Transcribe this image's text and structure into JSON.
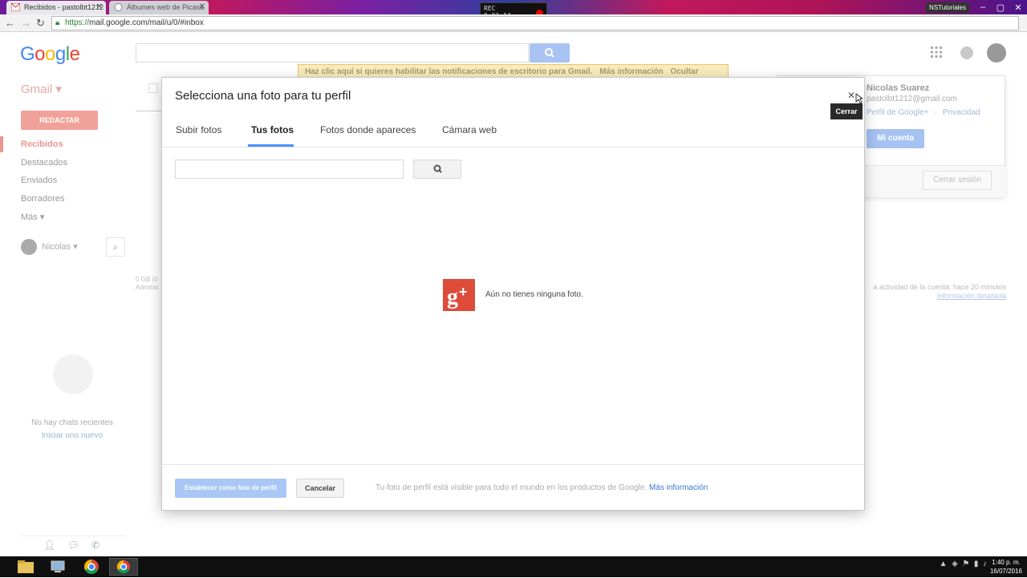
{
  "browser": {
    "tabs": [
      {
        "label": "Recibidos - pastolbt1212",
        "active": true
      },
      {
        "label": "Álbumes web de Picasa",
        "active": false
      }
    ],
    "recorder": {
      "top": "REC",
      "time": "0:01:14"
    },
    "window_user": "NSTutoriales",
    "url_scheme": "https://",
    "url_rest": "mail.google.com/mail/u/0/#inbox"
  },
  "header": {
    "logo_letters": [
      "G",
      "o",
      "o",
      "g",
      "l",
      "e"
    ],
    "notification": {
      "text": "Haz clic aquí si quieres habilitar las notificaciones de escritorio para Gmail.",
      "more_info": "Más información",
      "dismiss": "Ocultar"
    }
  },
  "sidebar": {
    "gmail_label": "Gmail ▾",
    "compose": "REDACTAR",
    "items": [
      {
        "label": "Recibidos",
        "active": true
      },
      {
        "label": "Destacados"
      },
      {
        "label": "Enviados"
      },
      {
        "label": "Borradores"
      },
      {
        "label": "Más ▾"
      }
    ],
    "chat_user": "Nicolas",
    "no_chats": "No hay chats recientes",
    "start_new": "Iniciar uno nuevo"
  },
  "underlay": {
    "storage_line1": "0 GB (0",
    "storage_line2": "Adminis",
    "activity_line1": "a actividad de la cuenta: hace 20 minutos",
    "activity_link": "Información detallada"
  },
  "account": {
    "name": "Nicolas Suarez",
    "email": "pastolbt1212@gmail.com",
    "profile_link": "Perfil de Google+",
    "separator": "-",
    "privacy_link": "Privacidad",
    "my_account": "Mi cuenta",
    "sign_out": "Cerrar sesión"
  },
  "dialog": {
    "title": "Selecciona una foto para tu perfil",
    "close_tooltip": "Cerrar",
    "tabs": [
      {
        "label": "Subir fotos"
      },
      {
        "label": "Tus fotos",
        "active": true
      },
      {
        "label": "Fotos donde apareces"
      },
      {
        "label": "Cámara web"
      }
    ],
    "empty_message": "Aún no tienes ninguna foto.",
    "set_photo": "Establecer como foto de perfil",
    "cancel": "Cancelar",
    "footer_note": "Tu foto de perfil está visible para todo el mundo en los productos de Google.",
    "footer_link": "Más información"
  },
  "taskbar": {
    "clock_time": "1:40 p. m.",
    "clock_date": "16/07/2016"
  },
  "colors": {
    "accent_blue": "#4d90fe",
    "gplus_red": "#dd4b39",
    "compose_red": "#f0a199"
  }
}
